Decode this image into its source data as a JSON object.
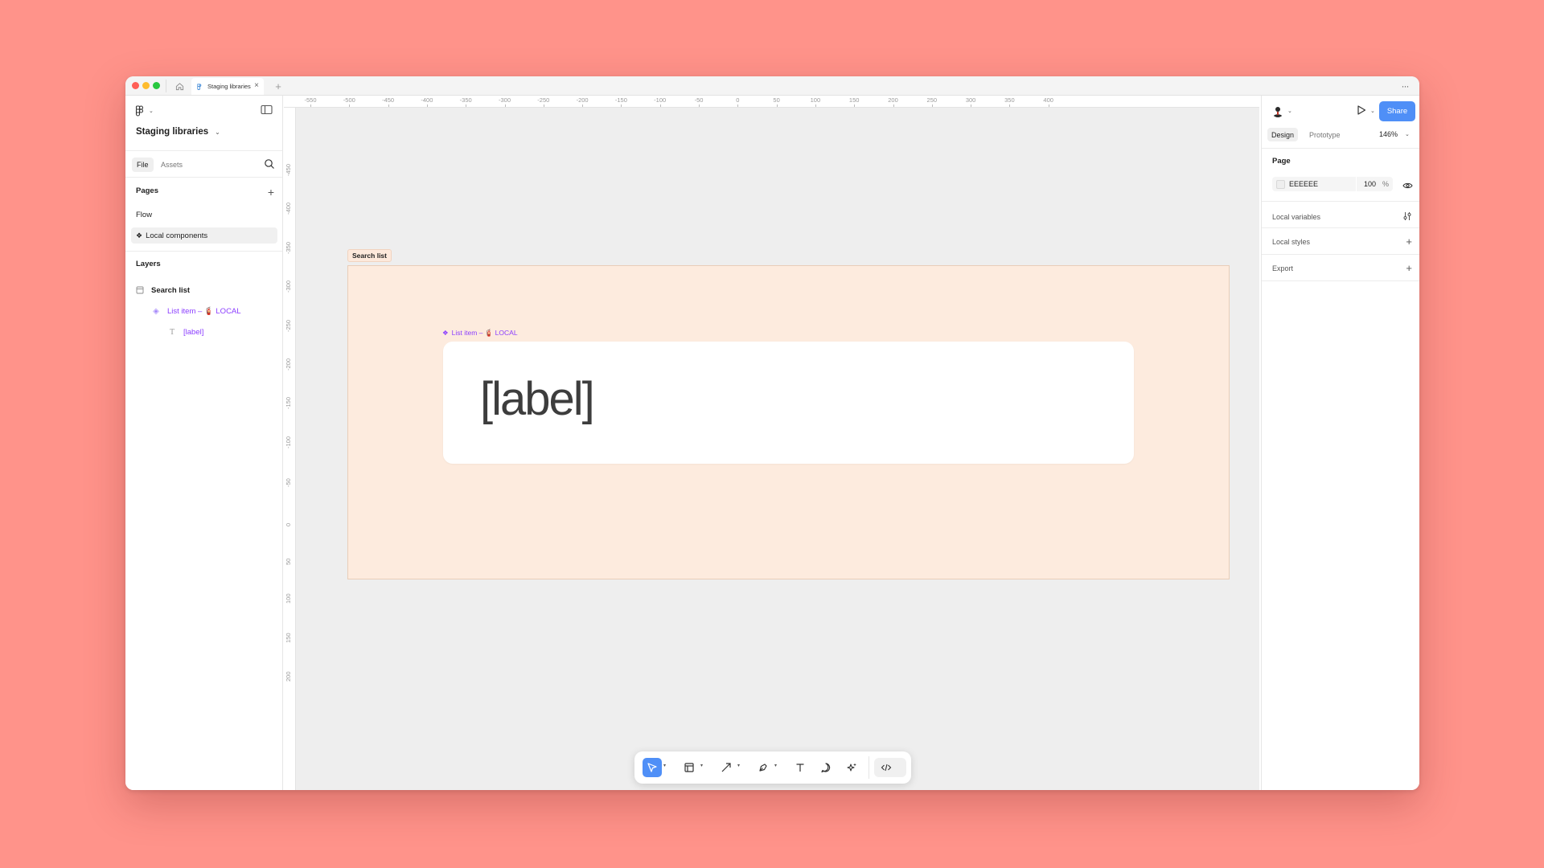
{
  "titlebar": {
    "tab_title": "Staging libraries",
    "close_glyph": "×",
    "new_tab_glyph": "+",
    "more_glyph": "···"
  },
  "left_panel": {
    "file_name": "Staging libraries",
    "tabs": {
      "file": "File",
      "assets": "Assets"
    },
    "pages_title": "Pages",
    "add_page_glyph": "+",
    "pages": [
      {
        "label": "Flow"
      },
      {
        "label": "Local components",
        "icon": "component-icon"
      }
    ],
    "layers_title": "Layers",
    "layers": [
      {
        "label": "Search list",
        "icon": "frame-icon"
      },
      {
        "label": "List item – 🧯 LOCAL",
        "icon": "component-instance-icon"
      },
      {
        "label": "[label]",
        "icon": "text-icon"
      }
    ]
  },
  "rulers": {
    "top": [
      "-550",
      "-500",
      "-450",
      "-400",
      "-350",
      "-300",
      "-250",
      "-200",
      "-150",
      "-100",
      "-50",
      "0",
      "50",
      "100",
      "150",
      "200",
      "250",
      "300",
      "350",
      "400"
    ],
    "left": [
      "-450",
      "-400",
      "-350",
      "-300",
      "-250",
      "-200",
      "-150",
      "-100",
      "-50",
      "0",
      "50",
      "100",
      "150",
      "200"
    ]
  },
  "canvas": {
    "background": "#EEEEEE",
    "frame_label": "Search list",
    "frame_fill": "#FDEBDE",
    "component_label": "List item – 🧯 LOCAL",
    "component_text": "[label]"
  },
  "toolbar": {
    "tools": [
      "move-tool",
      "frame-tool",
      "arrow-tool",
      "pen-tool",
      "text-tool",
      "comment-tool",
      "ai-tool",
      "dev-mode-tool"
    ]
  },
  "right_panel": {
    "share_label": "Share",
    "tabs": {
      "design": "Design",
      "prototype": "Prototype"
    },
    "zoom": "146%",
    "page_title": "Page",
    "page_color": "EEEEEE",
    "page_opacity": "100",
    "percent_sign": "%",
    "local_variables": "Local variables",
    "local_styles": "Local styles",
    "export": "Export",
    "add_glyph": "+"
  },
  "colors": {
    "accent": "#4F8FF7",
    "component": "#8B3DFF",
    "backdrop": "#FF938A"
  }
}
